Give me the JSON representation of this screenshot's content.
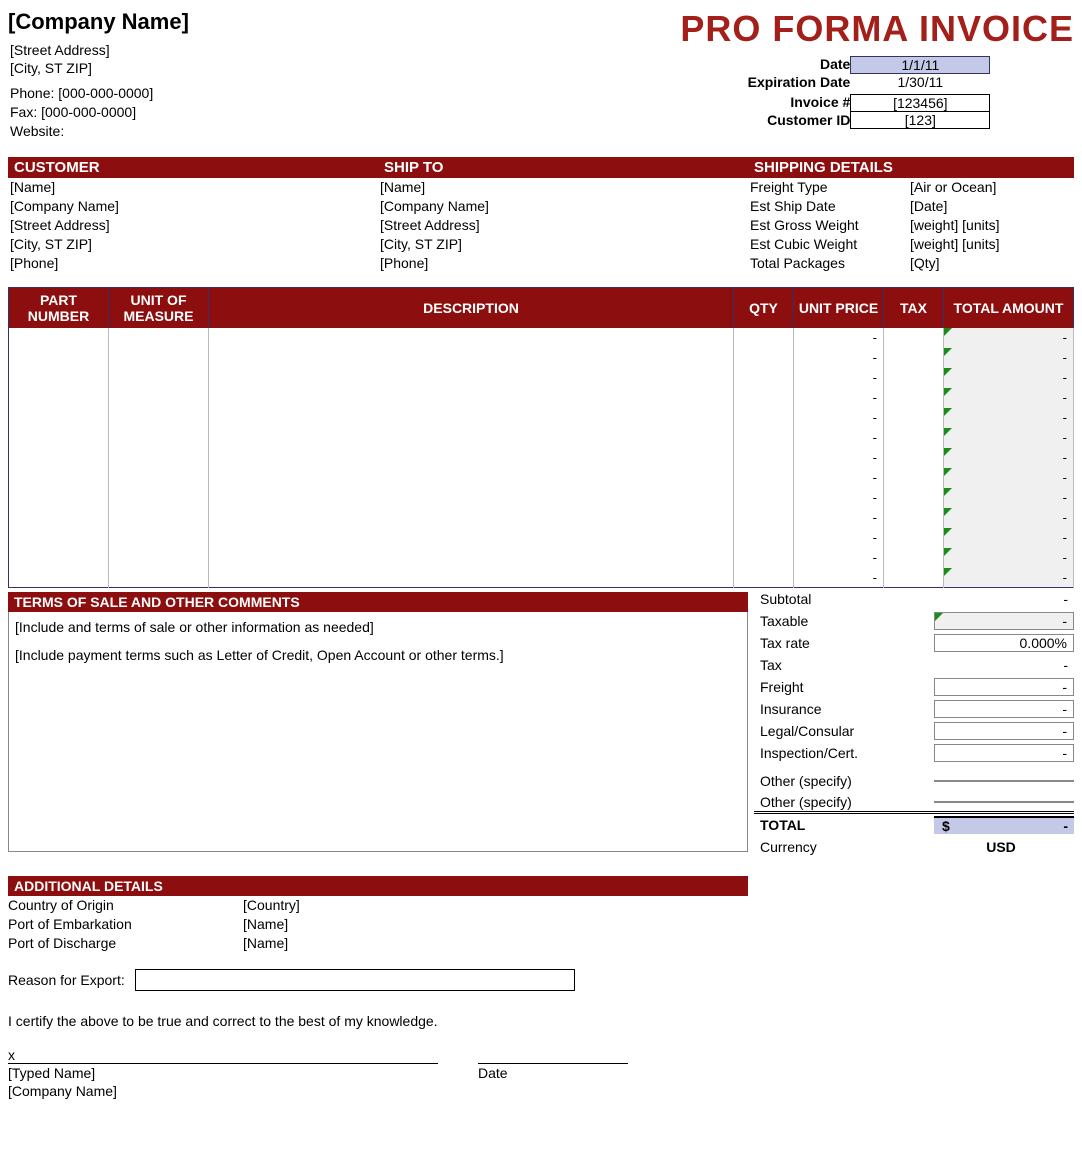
{
  "title": "PRO FORMA INVOICE",
  "company": {
    "name": "[Company Name]",
    "street": "[Street Address]",
    "citystzip": "[City, ST  ZIP]",
    "phone_label": "Phone:",
    "phone": "[000-000-0000]",
    "fax_label": "Fax:",
    "fax": "[000-000-0000]",
    "website_label": "Website:"
  },
  "meta": {
    "date_label": "Date",
    "date": "1/1/11",
    "exp_label": "Expiration Date",
    "exp": "1/30/11",
    "invno_label": "Invoice #",
    "invno": "[123456]",
    "custid_label": "Customer ID",
    "custid": "[123]"
  },
  "customer": {
    "head": "CUSTOMER",
    "name": "[Name]",
    "company": "[Company Name]",
    "street": "[Street Address]",
    "citystzip": "[City, ST  ZIP]",
    "phone": "[Phone]"
  },
  "shipto": {
    "head": "SHIP TO",
    "name": "[Name]",
    "company": "[Company Name]",
    "street": "[Street Address]",
    "citystzip": "[City, ST  ZIP]",
    "phone": "[Phone]"
  },
  "shipping": {
    "head": "SHIPPING DETAILS",
    "rows": [
      {
        "label": "Freight Type",
        "val": "[Air or Ocean]"
      },
      {
        "label": "Est Ship Date",
        "val": "[Date]"
      },
      {
        "label": "Est Gross Weight",
        "val": "[weight] [units]"
      },
      {
        "label": "Est Cubic Weight",
        "val": "[weight] [units]"
      },
      {
        "label": "Total Packages",
        "val": "[Qty]"
      }
    ]
  },
  "items_header": {
    "part": "PART NUMBER",
    "uom": "UNIT OF MEASURE",
    "desc": "DESCRIPTION",
    "qty": "QTY",
    "price": "UNIT PRICE",
    "tax": "TAX",
    "total": "TOTAL AMOUNT"
  },
  "item_rows": 13,
  "dash": "-",
  "terms": {
    "head": "TERMS OF SALE AND OTHER COMMENTS",
    "line1": "[Include and terms of sale or other information as needed]",
    "line2": "[Include payment terms such as Letter of Credit, Open Account or other terms.]"
  },
  "totals": {
    "subtotal_label": "Subtotal",
    "subtotal": "-",
    "taxable_label": "Taxable",
    "taxable": "-",
    "taxrate_label": "Tax rate",
    "taxrate": "0.000%",
    "tax_label": "Tax",
    "tax": "-",
    "freight_label": "Freight",
    "freight": "-",
    "insurance_label": "Insurance",
    "insurance": "-",
    "legal_label": "Legal/Consular",
    "legal": "-",
    "inspect_label": "Inspection/Cert.",
    "inspect": "-",
    "other1_label": "Other (specify)",
    "other1": "",
    "other2_label": "Other (specify)",
    "other2": "",
    "total_label": "TOTAL",
    "total_currency": "$",
    "total": "-",
    "currency_label": "Currency",
    "currency": "USD"
  },
  "additional": {
    "head": "ADDITIONAL DETAILS",
    "rows": [
      {
        "label": "Country of Origin",
        "val": "[Country]"
      },
      {
        "label": "Port of Embarkation",
        "val": "[Name]"
      },
      {
        "label": "Port of Discharge",
        "val": "[Name]"
      }
    ],
    "reason_label": "Reason for Export:",
    "cert": "I certify the above to be true and correct to the best of my knowledge.",
    "sig_x": "x",
    "typed_name": "[Typed Name]",
    "company": "[Company Name]",
    "date_label": "Date"
  }
}
